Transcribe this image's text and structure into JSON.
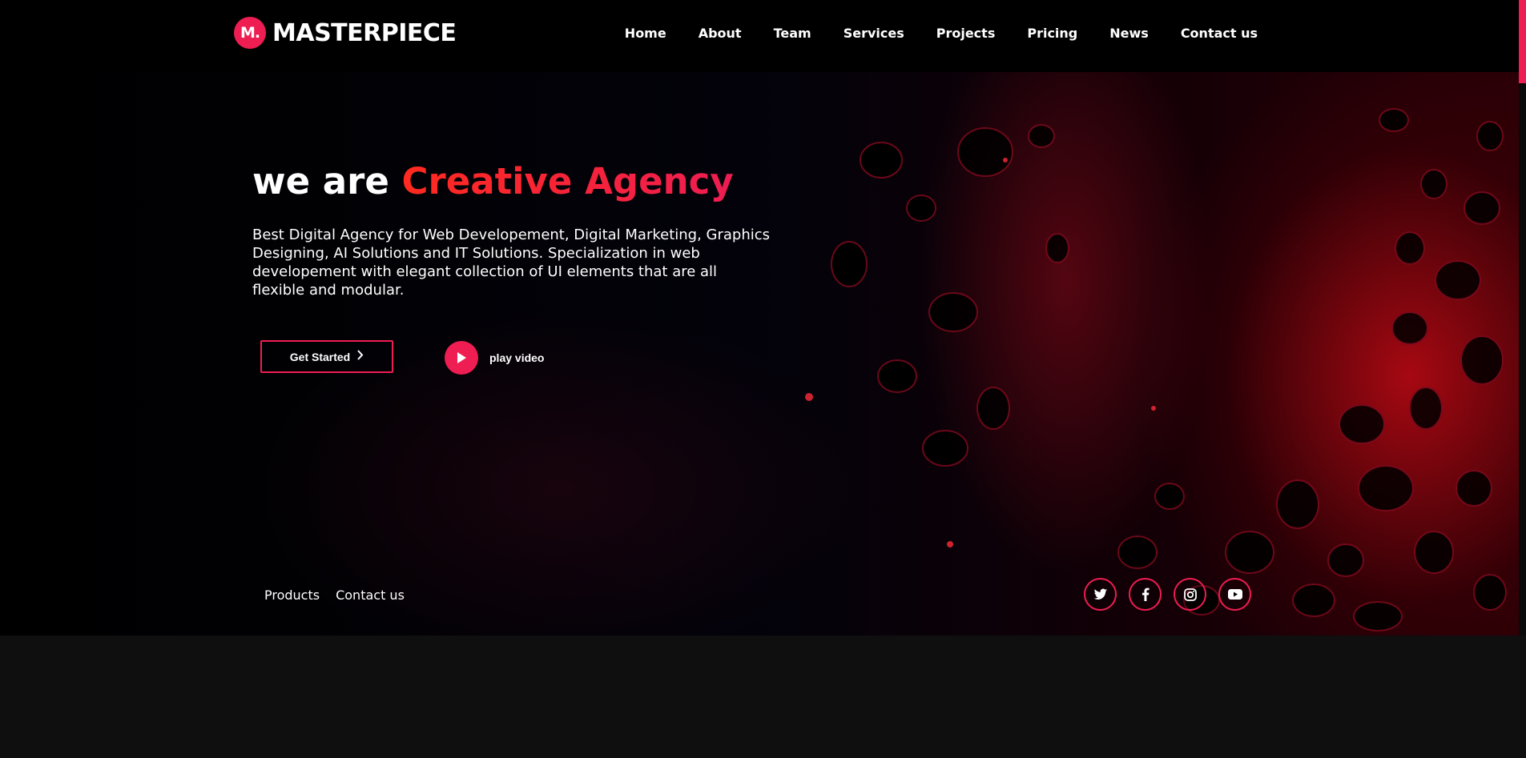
{
  "brand": {
    "badge": "M.",
    "name": "MASTERPIECE",
    "accent_color": "#ee1d52"
  },
  "nav": {
    "items": [
      {
        "label": "Home"
      },
      {
        "label": "About"
      },
      {
        "label": "Team"
      },
      {
        "label": "Services"
      },
      {
        "label": "Projects"
      },
      {
        "label": "Pricing"
      },
      {
        "label": "News"
      },
      {
        "label": "Contact us"
      }
    ]
  },
  "hero": {
    "headline_prefix": "we are ",
    "headline_accent": "Creative Agency",
    "description": "Best Digital Agency for Web Developement, Digital Marketing, Graphics Designing, AI Solutions and IT Solutions. Specialization in web developement with elegant collection of UI elements that are all flexible and modular.",
    "cta_label": "Get Started",
    "cta_icon": "chevron-right-icon",
    "play_label": "play video",
    "play_icon": "play-icon"
  },
  "footer_links": [
    {
      "label": "Products"
    },
    {
      "label": "Contact us"
    }
  ],
  "social": [
    {
      "icon": "twitter-icon"
    },
    {
      "icon": "facebook-icon"
    },
    {
      "icon": "instagram-icon"
    },
    {
      "icon": "youtube-icon"
    }
  ]
}
